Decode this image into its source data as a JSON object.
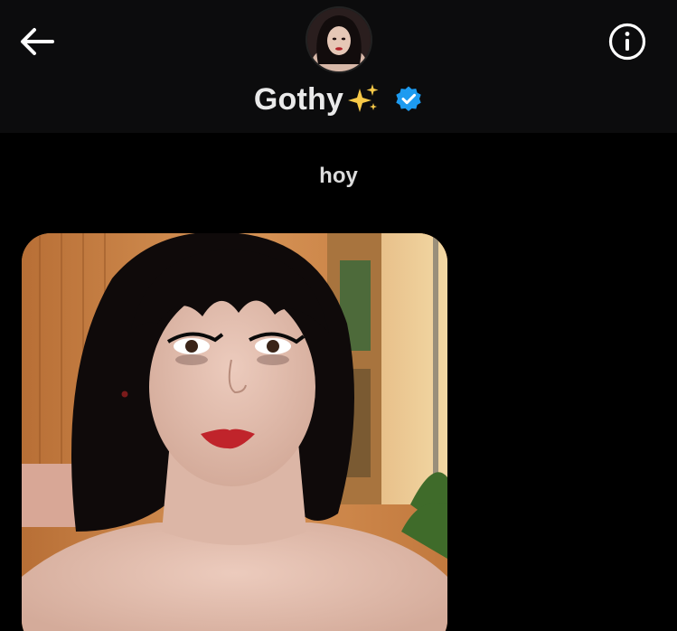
{
  "header": {
    "contact_name": "Gothy",
    "name_emoji": "sparkles-icon",
    "verified": true,
    "back_icon": "arrow-left-icon",
    "info_icon": "info-circle-icon"
  },
  "conversation": {
    "date_label": "hoy",
    "messages": [
      {
        "type": "photo",
        "sender": "contact"
      }
    ]
  },
  "colors": {
    "header_bg": "#0c0c0d",
    "screen_bg": "#000000",
    "verified_badge": "#1d9bf0",
    "sparkle": "#f7c948"
  }
}
